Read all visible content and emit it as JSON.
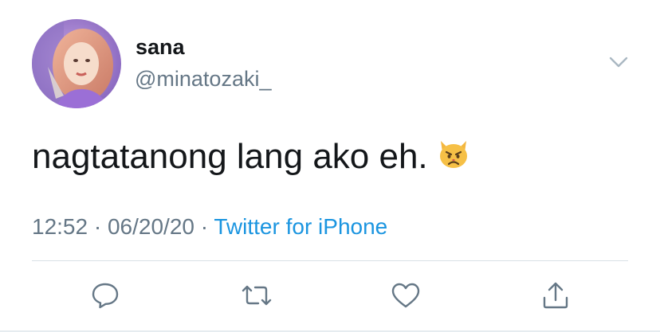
{
  "tweet": {
    "display_name": "sana",
    "handle": "@minatozaki_",
    "text": "nagtatanong lang ako eh.",
    "emoji_icon": "pouting-cat-emoji",
    "time": "12:52",
    "date": "06/20/20",
    "separator": "·",
    "source": "Twitter for iPhone"
  },
  "icons": {
    "menu": "chevron-down-icon",
    "reply": "reply-icon",
    "retweet": "retweet-icon",
    "like": "heart-icon",
    "share": "share-icon"
  },
  "colors": {
    "text": "#14171a",
    "secondary": "#657786",
    "link": "#1b95e0",
    "icon": "#657786",
    "divider": "#d9e0e6"
  }
}
